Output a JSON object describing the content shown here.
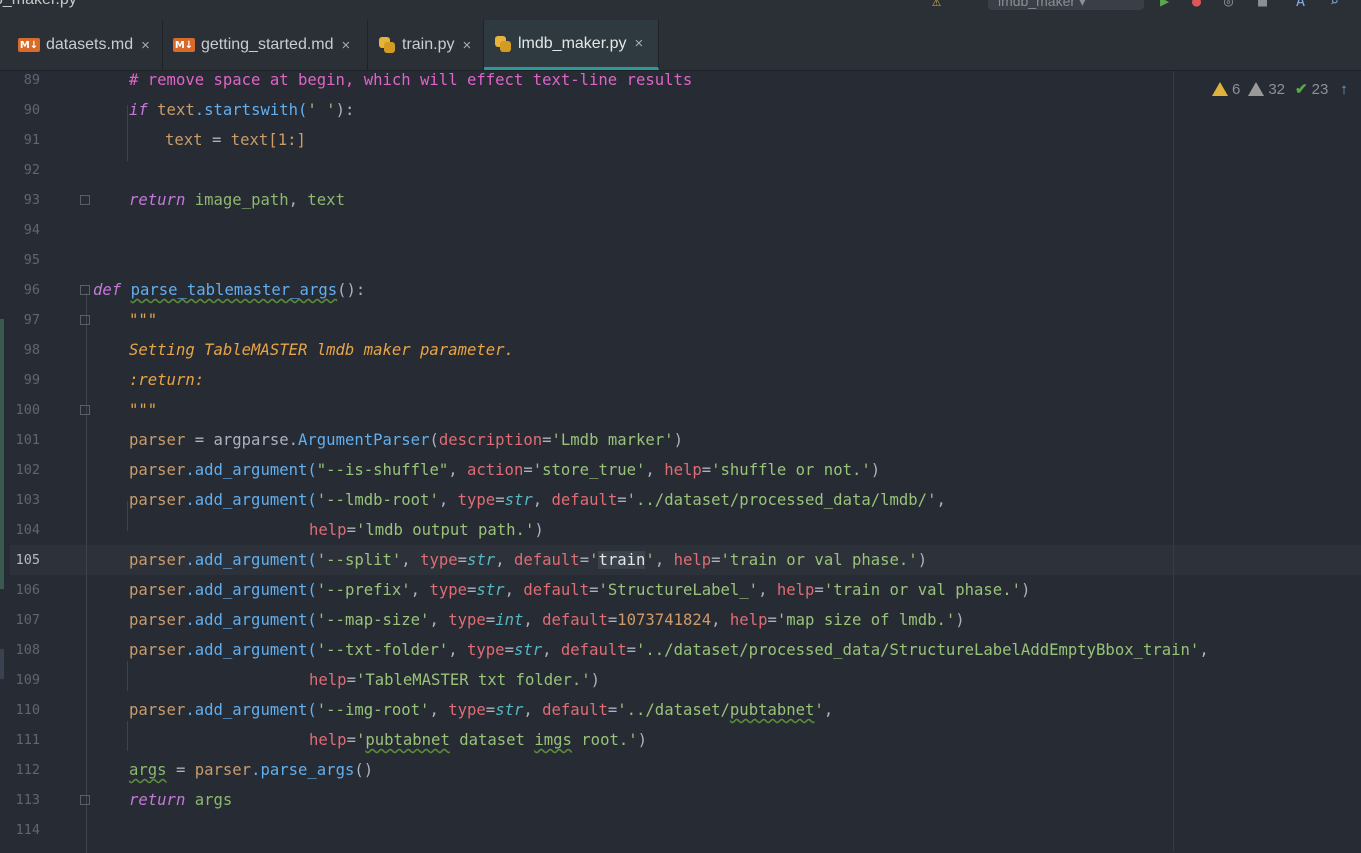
{
  "window": {
    "title": "b_maker.py",
    "run_config": "lmdb_maker"
  },
  "tabs": [
    {
      "label": "datasets.md",
      "icon": "markdown-icon",
      "active": false
    },
    {
      "label": "getting_started.md",
      "icon": "markdown-icon",
      "active": false
    },
    {
      "label": "train.py",
      "icon": "python-icon",
      "active": false
    },
    {
      "label": "lmdb_maker.py",
      "icon": "python-icon",
      "active": true
    }
  ],
  "icons": {
    "markdown_badge": "M↓",
    "close": "×"
  },
  "inspections": {
    "errors": "6",
    "warnings": "32",
    "weak": "23"
  },
  "editor": {
    "current_line": 105,
    "line_numbers": [
      "89",
      "90",
      "91",
      "92",
      "93",
      "94",
      "95",
      "96",
      "97",
      "98",
      "99",
      "100",
      "101",
      "102",
      "103",
      "104",
      "105",
      "106",
      "107",
      "108",
      "109",
      "110",
      "111",
      "112",
      "113",
      "114"
    ]
  },
  "code": {
    "l89": "# remove space at begin, which will effect text-line results",
    "l90_kw": "if",
    "l90_var": "text",
    "l90_fn": ".startswith(",
    "l90_str": "' '",
    "l90_end": "):",
    "l91_var": "text",
    "l91_eq": " = ",
    "l91_var2": "text",
    "l91_br": "[",
    "l91_num": "1",
    "l91_end": ":]",
    "l93_kw": "return",
    "l93_a": "image_path",
    "l93_c": ", ",
    "l93_b": "text",
    "l96_kw": "def",
    "l96_fn": "parse_tablemaster_args",
    "l96_end": "():",
    "l97": "\"\"\"",
    "l98": "Setting TableMASTER lmdb maker parameter.",
    "l99": ":return:",
    "l100": "\"\"\"",
    "l101_var": "parser",
    "l101_eq": " = argparse.",
    "l101_cls": "ArgumentParser",
    "l101_p": "(",
    "l101_param": "description",
    "l101_e": "=",
    "l101_str": "'Lmdb marker'",
    "l101_end": ")",
    "m": ".add_argument(",
    "l102_s1": "\"--is-shuffle\"",
    "l102_c1": ", ",
    "l102_p1": "action",
    "l102_s2": "'store_true'",
    "l102_p2": "help",
    "l102_s3": "'shuffle or not.'",
    "l103_s1": "'--lmdb-root'",
    "l103_p1": "type",
    "l103_t": "str",
    "l103_p2": "default",
    "l103_s2": "'../dataset/processed_data/lmdb/'",
    "l104_p": "help",
    "l104_s": "'lmdb output path.'",
    "l105_s1": "'--split'",
    "l105_p1": "type",
    "l105_t": "str",
    "l105_p2": "default",
    "l105_q1": "'",
    "l105_hl": "train",
    "l105_q2": "'",
    "l105_p3": "help",
    "l105_s3": "'train or val phase.'",
    "l106_s1": "'--prefix'",
    "l106_p1": "type",
    "l106_t": "str",
    "l106_p2": "default",
    "l106_s2": "'StructureLabel_'",
    "l106_p3": "help",
    "l106_s3": "'train or val phase.'",
    "l107_s1": "'--map-size'",
    "l107_p1": "type",
    "l107_t": "int",
    "l107_p2": "default",
    "l107_n": "1073741824",
    "l107_p3": "help",
    "l107_s3": "'map size of lmdb.'",
    "l108_s1": "'--txt-folder'",
    "l108_p1": "type",
    "l108_t": "str",
    "l108_p2": "default",
    "l108_s2": "'../dataset/processed_data/StructureLabelAddEmptyBbox_train'",
    "l109_p": "help",
    "l109_s": "'TableMASTER txt folder.'",
    "l110_s1a": "'--img-root'",
    "l110_p1": "type",
    "l110_t": "str",
    "l110_p2": "default",
    "l110_s2a": "'../dataset/",
    "l110_s2b": "pubtabnet",
    "l110_s2c": "'",
    "l111_p": "help",
    "l111_s1": "'",
    "l111_w": "pubtabnet",
    "l111_s2": " dataset ",
    "l111_w2": "imgs",
    "l111_s3": " root.'",
    "l112_var": "args",
    "l112_eq": " = ",
    "l112_v2": "parser",
    "l112_fn": ".parse_args",
    "l112_end": "()",
    "l113_kw": "return",
    "l113_v": "args"
  }
}
